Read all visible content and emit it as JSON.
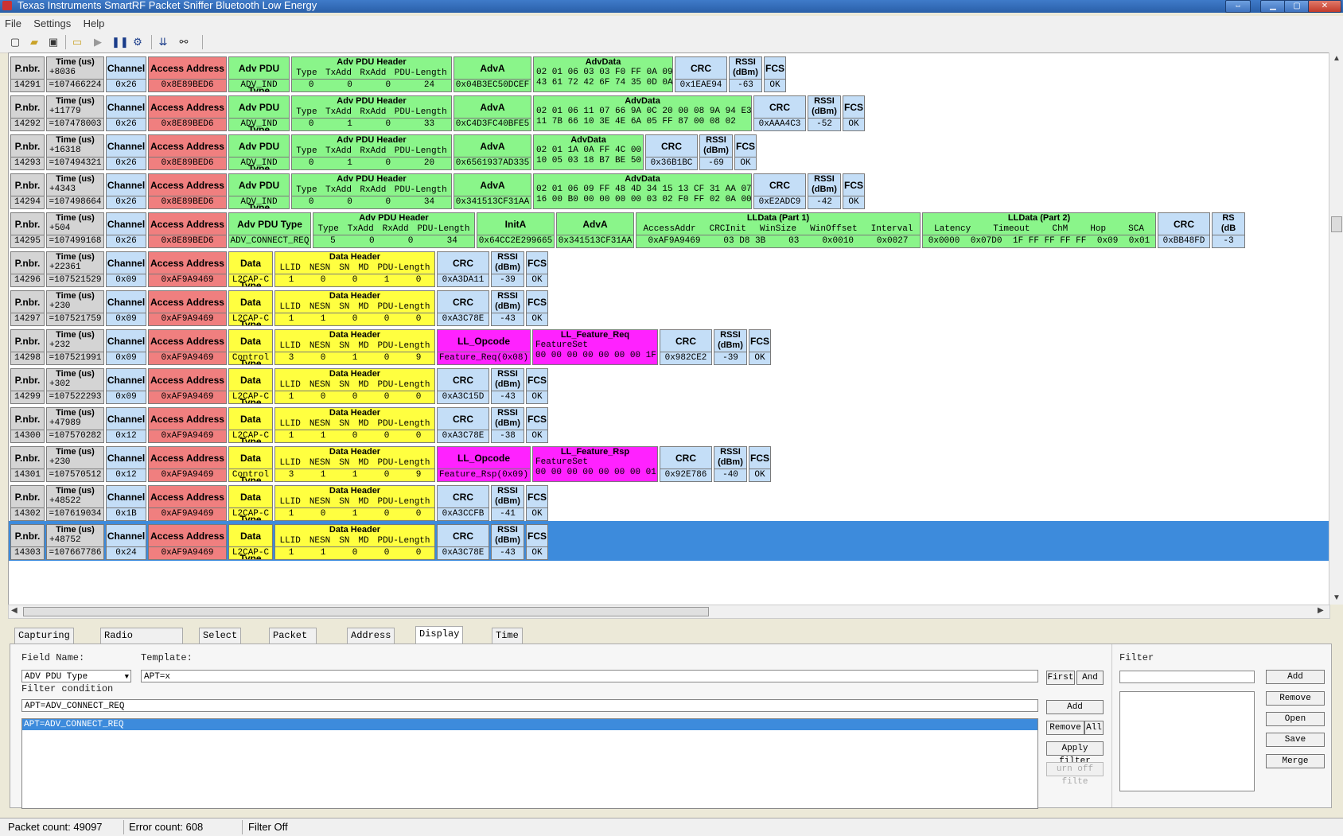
{
  "window": {
    "title": "Texas Instruments SmartRF Packet Sniffer Bluetooth Low Energy"
  },
  "menu": [
    "File",
    "Settings",
    "Help"
  ],
  "toolbar_icons": [
    "new-icon",
    "open-icon",
    "save-icon",
    "folder-icon",
    "play-icon",
    "pause-icon",
    "settings-icon",
    "scroll-down-icon",
    "connect-icon"
  ],
  "labels": {
    "pnbr": "P.nbr.",
    "time": "Time (us)",
    "channel": "Channel",
    "aa": "Access Address",
    "advpdutype": "Adv PDU Type",
    "advpduheader": "Adv PDU Header",
    "adva": "AdvA",
    "advdata": "AdvData",
    "crc": "CRC",
    "rssi1": "RSSI",
    "rssi2": "(dBm)",
    "fcs": "FCS",
    "datatype": "Data Type",
    "dataheader": "Data Header",
    "initA": "InitA",
    "lldata1": "LLData (Part 1)",
    "lldata2": "LLData (Part 2)",
    "llopcode": "LL_Opcode",
    "featureset": "FeatureSet",
    "advsub": [
      "Type",
      "TxAdd",
      "RxAdd",
      "PDU-Length"
    ],
    "datasub": [
      "LLID",
      "NESN",
      "SN",
      "MD",
      "PDU-Length"
    ],
    "ll1sub": [
      "AccessAddr",
      "CRCInit",
      "WinSize",
      "WinOffset",
      "Interval"
    ],
    "ll2sub": [
      "Latency",
      "Timeout",
      "ChM",
      "Hop",
      "SCA"
    ]
  },
  "packets": [
    {
      "kind": "adv",
      "num": "14291",
      "delta": "+8036",
      "abs": "=107466224",
      "channel": "0x26",
      "aa": "0x8E89BED6",
      "pdutype": "ADV_IND",
      "hdr": [
        "0",
        "0",
        "0",
        "24"
      ],
      "adva": "0x04B3EC50DCEF",
      "advdata": [
        "02 01 06 03 03 F0 FF 0A 09",
        "43 61 72 42 6F 74 35 0D 0A"
      ],
      "crc": "0x1EAE94",
      "rssi": "-63",
      "fcs": "OK"
    },
    {
      "kind": "adv",
      "num": "14292",
      "delta": "+11779",
      "abs": "=107478003",
      "channel": "0x26",
      "aa": "0x8E89BED6",
      "pdutype": "ADV_IND",
      "hdr": [
        "0",
        "1",
        "0",
        "33"
      ],
      "adva": "0xC4D3FC40BFE5",
      "advdata": [
        "02 01 06 11 07 66 9A 0C 20 00 08 9A 94 E3",
        "11 7B 66 10 3E 4E 6A 05 FF 87 00 08 02"
      ],
      "crc": "0xAAA4C3",
      "rssi": "-52",
      "fcs": "OK"
    },
    {
      "kind": "adv",
      "num": "14293",
      "delta": "+16318",
      "abs": "=107494321",
      "channel": "0x26",
      "aa": "0x8E89BED6",
      "pdutype": "ADV_IND",
      "hdr": [
        "0",
        "1",
        "0",
        "20"
      ],
      "adva": "0x6561937AD335",
      "advdata": [
        "02 01 1A 0A FF 4C 00",
        "10 05 03 18 B7 BE 50"
      ],
      "crc": "0x36B1BC",
      "rssi": "-69",
      "fcs": "OK"
    },
    {
      "kind": "adv",
      "num": "14294",
      "delta": "+4343",
      "abs": "=107498664",
      "channel": "0x26",
      "aa": "0x8E89BED6",
      "pdutype": "ADV_IND",
      "hdr": [
        "0",
        "0",
        "0",
        "34"
      ],
      "adva": "0x341513CF31AA",
      "advdata": [
        "02 01 06 09 FF 48 4D 34 15 13 CF 31 AA 07",
        "16 00 B0 00 00 00 00 03 02 F0 FF 02 0A 00"
      ],
      "crc": "0xE2ADC9",
      "rssi": "-42",
      "fcs": "OK"
    },
    {
      "kind": "conn",
      "num": "14295",
      "delta": "+504",
      "abs": "=107499168",
      "channel": "0x26",
      "aa": "0x8E89BED6",
      "pdutype": "ADV_CONNECT_REQ",
      "hdr": [
        "5",
        "0",
        "0",
        "34"
      ],
      "inita": "0x64CC2E299665",
      "adva": "0x341513CF31AA",
      "ll1": [
        "0xAF9A9469",
        "03 D8 3B",
        "03",
        "0x0010",
        "0x0027"
      ],
      "ll2": [
        "0x0000",
        "0x07D0",
        "1F FF FF FF FF",
        "0x09",
        "0x01"
      ],
      "crc": "0xBB48FD",
      "rssi_partial": "RS",
      "rssi_partial2": "(dB",
      "rssi_partial3": "-3"
    },
    {
      "kind": "data",
      "num": "14296",
      "delta": "+22361",
      "abs": "=107521529",
      "channel": "0x09",
      "aa": "0xAF9A9469",
      "dtype": "L2CAP-C",
      "hdr": [
        "1",
        "0",
        "0",
        "1",
        "0"
      ],
      "crc": "0xA3DA11",
      "rssi": "-39",
      "fcs": "OK"
    },
    {
      "kind": "data",
      "num": "14297",
      "delta": "+230",
      "abs": "=107521759",
      "channel": "0x09",
      "aa": "0xAF9A9469",
      "dtype": "L2CAP-C",
      "hdr": [
        "1",
        "1",
        "0",
        "0",
        "0"
      ],
      "crc": "0xA3C78E",
      "rssi": "-43",
      "fcs": "OK"
    },
    {
      "kind": "ctrl",
      "num": "14298",
      "delta": "+232",
      "abs": "=107521991",
      "channel": "0x09",
      "aa": "0xAF9A9469",
      "dtype": "Control",
      "hdr": [
        "3",
        "0",
        "1",
        "0",
        "9"
      ],
      "opcode": "Feature_Req(0x08)",
      "feat_title": "LL_Feature_Req",
      "feat": "00 00 00 00 00 00 00 1F",
      "crc": "0x982CE2",
      "rssi": "-39",
      "fcs": "OK"
    },
    {
      "kind": "data",
      "num": "14299",
      "delta": "+302",
      "abs": "=107522293",
      "channel": "0x09",
      "aa": "0xAF9A9469",
      "dtype": "L2CAP-C",
      "hdr": [
        "1",
        "0",
        "0",
        "0",
        "0"
      ],
      "crc": "0xA3C15D",
      "rssi": "-43",
      "fcs": "OK"
    },
    {
      "kind": "data",
      "num": "14300",
      "delta": "+47989",
      "abs": "=107570282",
      "channel": "0x12",
      "aa": "0xAF9A9469",
      "dtype": "L2CAP-C",
      "hdr": [
        "1",
        "1",
        "0",
        "0",
        "0"
      ],
      "crc": "0xA3C78E",
      "rssi": "-38",
      "fcs": "OK"
    },
    {
      "kind": "ctrl",
      "num": "14301",
      "delta": "+230",
      "abs": "=107570512",
      "channel": "0x12",
      "aa": "0xAF9A9469",
      "dtype": "Control",
      "hdr": [
        "3",
        "1",
        "1",
        "0",
        "9"
      ],
      "opcode": "Feature_Rsp(0x09)",
      "feat_title": "LL_Feature_Rsp",
      "feat": "00 00 00 00 00 00 00 01",
      "crc": "0x92E786",
      "rssi": "-40",
      "fcs": "OK"
    },
    {
      "kind": "data",
      "num": "14302",
      "delta": "+48522",
      "abs": "=107619034",
      "channel": "0x1B",
      "aa": "0xAF9A9469",
      "dtype": "L2CAP-C",
      "hdr": [
        "1",
        "0",
        "1",
        "0",
        "0"
      ],
      "crc": "0xA3CCFB",
      "rssi": "-41",
      "fcs": "OK"
    },
    {
      "kind": "data",
      "num": "14303",
      "delta": "+48752",
      "abs": "=107667786",
      "channel": "0x24",
      "aa": "0xAF9A9469",
      "dtype": "L2CAP-C",
      "hdr": [
        "1",
        "1",
        "0",
        "0",
        "0"
      ],
      "crc": "0xA3C78E",
      "rssi": "-43",
      "fcs": "OK",
      "selected": true
    }
  ],
  "tabs": [
    "Capturing device",
    "Radio Configuration",
    "Select fields",
    "Packet details",
    "Address book",
    "Display filter",
    "Time line"
  ],
  "active_tab": "Display filter",
  "filter": {
    "field_name_label": "Field Name:",
    "template_label": "Template:",
    "field_name_value": "ADV PDU Type",
    "template_value": "APT=x",
    "condition_label": "Filter condition",
    "condition_value": "APT=ADV_CONNECT_REQ",
    "list_items": [
      "APT=ADV_CONNECT_REQ"
    ],
    "btn_first": "First",
    "btn_and": "And",
    "btn_add": "Add",
    "btn_remove": "Remove",
    "btn_all": "All",
    "btn_apply": "Apply filter",
    "btn_turnoff": "urn off filte",
    "right_label": "Filter",
    "right_add": "Add",
    "right_remove": "Remove",
    "right_open": "Open",
    "right_save": "Save",
    "right_merge": "Merge"
  },
  "status": {
    "packet_count": "Packet count: 49097",
    "error_count": "Error count: 608",
    "filter": "Filter Off"
  }
}
